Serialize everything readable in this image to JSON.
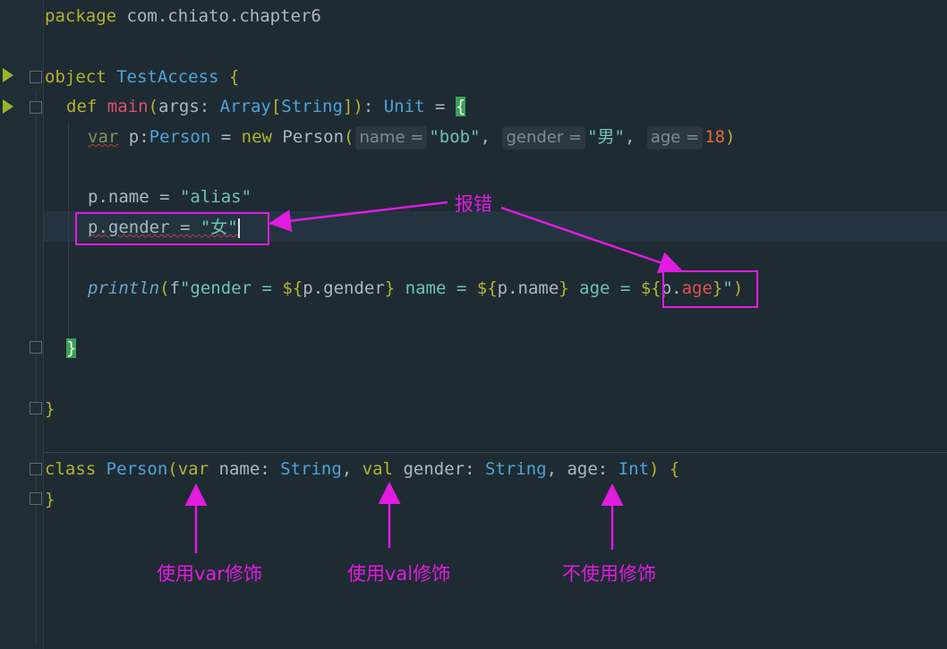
{
  "editor": {
    "lines": {
      "package": {
        "kw": "package",
        "name": "com.chiato.chapter6"
      },
      "object_decl": {
        "kw": "object",
        "name": "TestAccess",
        "brace": "{"
      },
      "main_decl": {
        "kw": "def",
        "fn": "main",
        "open": "(",
        "param": "args: ",
        "arr": "Array",
        "lb": "[",
        "str": "String",
        "rb": "]",
        "close": ")",
        "colon": ": ",
        "unit": "Unit",
        "eq": " = ",
        "brace": "{"
      },
      "var_decl": {
        "kw": "var",
        "name": " p:",
        "type": "Person",
        "eq": " = ",
        "new": "new",
        "cls": " Person",
        "open": "(",
        "hint1": "name =",
        "v1": "\"bob\"",
        "comma1": ", ",
        "hint2": "gender =",
        "v2": "\"男\"",
        "comma2": ", ",
        "hint3": "age =",
        "v3": "18",
        "close": ")"
      },
      "assign_name": {
        "lhs": "p.name = ",
        "val": "\"alias\""
      },
      "assign_gender": {
        "lhs": "p.gender",
        "eq": " = ",
        "val": "\"女\""
      },
      "println": {
        "fn": "println",
        "open": "(",
        "f": "f",
        "s1": "\"gender = ",
        "i1": "${",
        "e1": "p.gender",
        "c1": "}",
        "s2": " name = ",
        "i2": "${",
        "e2": "p.name",
        "c2": "}",
        "s3": " age = ",
        "i3": "${",
        "e3a": "p.",
        "e3b": "age",
        "c3": "}",
        "s4": "\"",
        "close": ")"
      },
      "close_main": "}",
      "close_object": "}",
      "class_decl": {
        "kw": "class",
        "name": " Person",
        "open": "(",
        "var": "var",
        "p1": " name: ",
        "t1": "String",
        "comma1": ", ",
        "val": "val",
        "p2": " gender: ",
        "t2": "String",
        "comma2": ", ",
        "p3": "age: ",
        "t3": "Int",
        "close": ")",
        "brace": " {"
      },
      "close_class": "}"
    }
  },
  "annotations": {
    "error_label": "报错",
    "label_var": "使用var修饰",
    "label_val": "使用val修饰",
    "label_none": "不使用修饰"
  },
  "colors": {
    "annotation": "#e11be0",
    "keyword": "#b5b22e",
    "type": "#4ea3d6",
    "string": "#6fc3b0",
    "number": "#e36a35"
  }
}
